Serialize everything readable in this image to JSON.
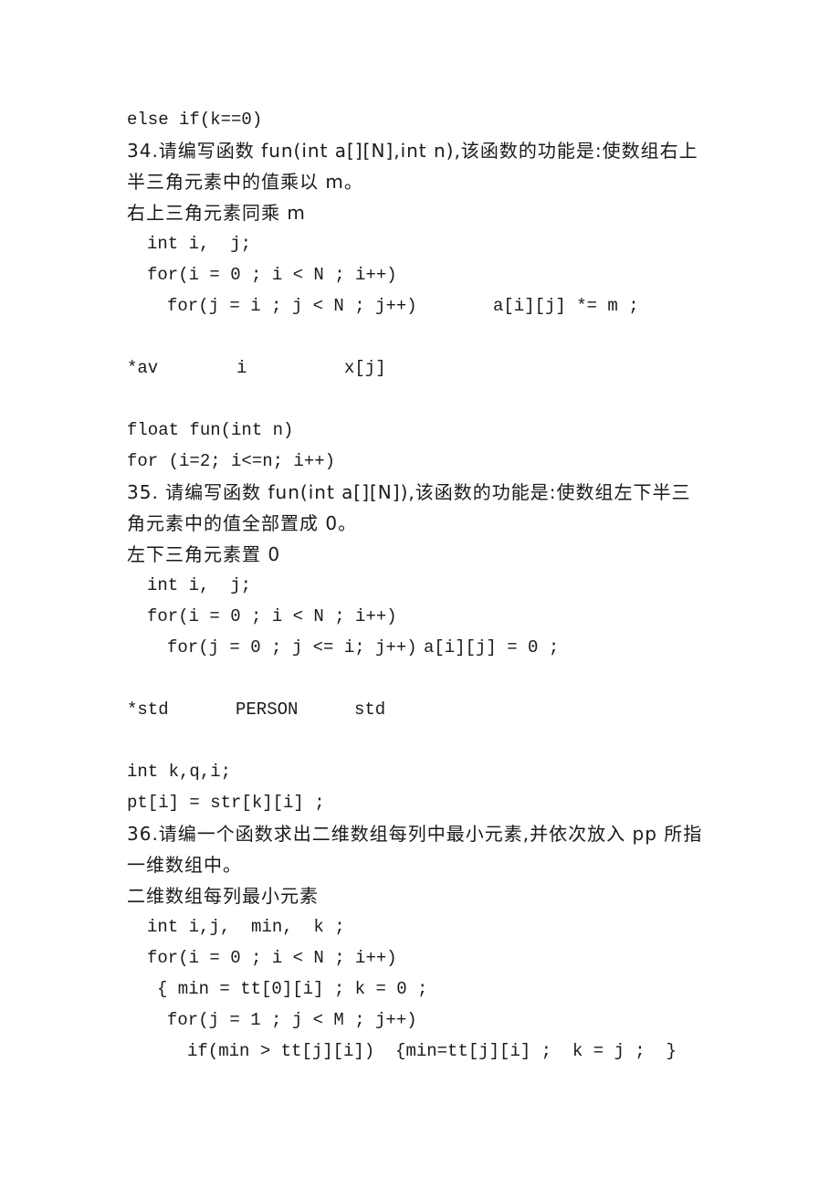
{
  "document": {
    "lines": [
      {
        "text": "else if(k==0)",
        "kind": "code"
      },
      {
        "text": "34.请编写函数 fun(int a[][N],int n),该函数的功能是:使数组右上",
        "kind": "question"
      },
      {
        "text": "半三角元素中的值乘以 m。",
        "kind": "question"
      },
      {
        "text": "右上三角元素同乘 m",
        "kind": "heading"
      },
      {
        "text": "int i,  j;",
        "kind": "code"
      },
      {
        "text": "for(i = 0 ; i < N ; i++)",
        "kind": "code"
      },
      {
        "text": "for(j = i ; j < N ; j++)",
        "kind": "code",
        "trailing": "a[i][j] *= m ;"
      },
      {
        "text": "*av",
        "kind": "blank-answer",
        "parts": [
          "*av",
          "i",
          "x[j]"
        ]
      },
      {
        "text": "float fun(int n)",
        "kind": "code"
      },
      {
        "text": "for (i=2; i<=n; i++)",
        "kind": "code"
      },
      {
        "text": "35. 请编写函数 fun(int a[][N]),该函数的功能是:使数组左下半三",
        "kind": "question"
      },
      {
        "text": "角元素中的值全部置成 0。",
        "kind": "question"
      },
      {
        "text": "左下三角元素置 0",
        "kind": "heading"
      },
      {
        "text": "int i,  j;",
        "kind": "code"
      },
      {
        "text": "for(i = 0 ; i < N ; i++)",
        "kind": "code"
      },
      {
        "text": "for(j = 0 ; j <= i; j++)",
        "kind": "code",
        "trailing": "a[i][j] = 0 ;"
      },
      {
        "text": "*std",
        "kind": "blank-answer",
        "parts": [
          "*std",
          "PERSON",
          "std"
        ]
      },
      {
        "text": "int k,q,i;",
        "kind": "code"
      },
      {
        "text": "pt[i] = str[k][i] ;",
        "kind": "code"
      },
      {
        "text": "36.请编一个函数求出二维数组每列中最小元素,并依次放入 pp 所指",
        "kind": "question"
      },
      {
        "text": "一维数组中。",
        "kind": "question"
      },
      {
        "text": "二维数组每列最小元素",
        "kind": "heading"
      },
      {
        "text": "int i,j,  min,  k ;",
        "kind": "code"
      },
      {
        "text": "for(i = 0 ; i < N ; i++)",
        "kind": "code"
      },
      {
        "text": "{ min = tt[0][i] ; k = 0 ;",
        "kind": "code"
      },
      {
        "text": "for(j = 1 ; j < M ; j++)",
        "kind": "code"
      },
      {
        "text": "if(min > tt[j][i])  {min=tt[j][i] ;  k = j ;  }",
        "kind": "code"
      }
    ]
  }
}
